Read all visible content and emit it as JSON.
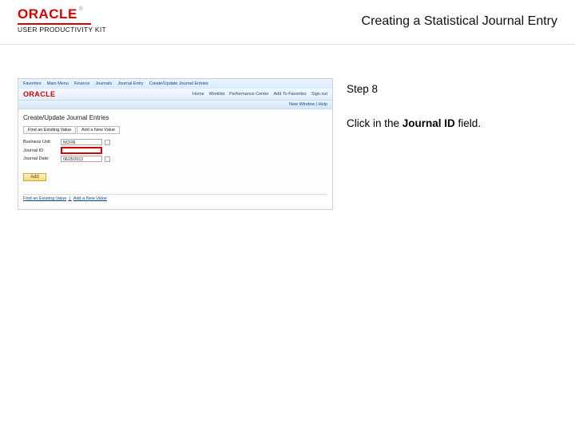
{
  "header": {
    "logo_word": "ORACLE",
    "logo_tm": "®",
    "upk": "USER PRODUCTIVITY KIT",
    "title": "Creating a Statistical Journal Entry"
  },
  "instruction": {
    "step_label": "Step 8",
    "line_pre": "Click in the ",
    "line_bold": "Journal ID",
    "line_post": " field."
  },
  "shot": {
    "nav": {
      "items": [
        "Favorites",
        "Main Menu",
        "Finance",
        "Journals",
        "Journal Entry",
        "Create/Update Journal Entries"
      ]
    },
    "logo": "ORACLE",
    "menubar": {
      "items": [
        "Home",
        "Worklist",
        "Performance Center",
        "Add To Favorites",
        "Sign out"
      ]
    },
    "bluebar_text": "New Window | Help",
    "page_title": "Create/Update Journal Entries",
    "tabs": {
      "tab1": "Find an Existing Value",
      "tab2": "Add a New Value"
    },
    "form": {
      "bu_label": "Business Unit:",
      "bu_value": "NCFIN",
      "jid_label": "Journal ID:",
      "jid_value": "",
      "jdate_label": "Journal Date:",
      "jdate_value": "06/25/2013"
    },
    "add_button": "Add",
    "bottom_tabs": {
      "a": "Find an Existing Value",
      "sep": " | ",
      "b": "Add a New Value"
    }
  }
}
